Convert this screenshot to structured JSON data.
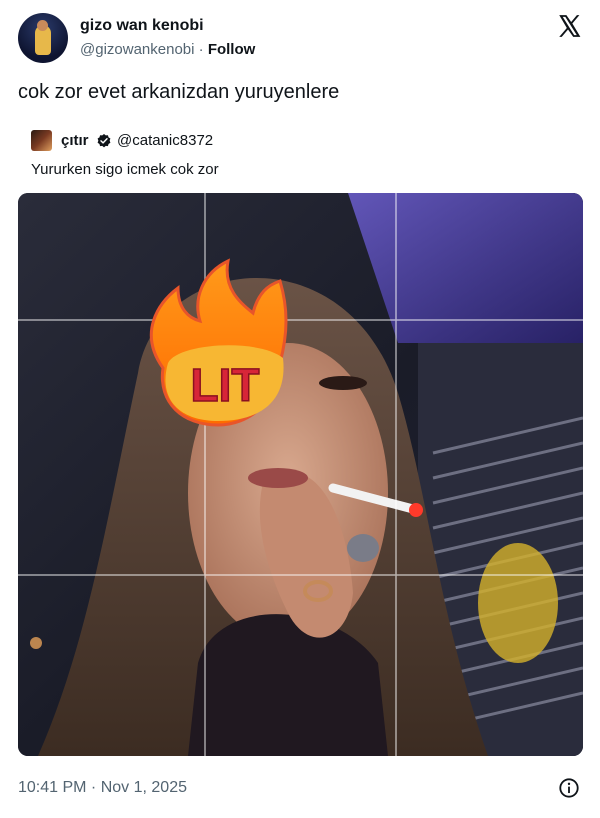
{
  "author": {
    "name": "gizo wan kenobi",
    "handle": "@gizowankenobi",
    "separator": "·",
    "follow_label": "Follow"
  },
  "tweet": {
    "text": "cok zor evet arkanizdan yuruyenlere"
  },
  "quoted": {
    "name": "çıtır",
    "handle": "@catanic8372",
    "text": "Yururken sigo icmek cok zor",
    "verified": true
  },
  "media": {
    "sticker_text": "LIT"
  },
  "meta": {
    "timestamp": "10:41 PM · Nov 1, 2025"
  },
  "icons": {
    "platform": "x-logo-icon",
    "verified": "verified-badge-icon",
    "info": "info-icon"
  },
  "colors": {
    "text": "#0f1419",
    "secondary": "#536471",
    "sticker_fill": "#f7b733",
    "sticker_text": "#d72638"
  }
}
